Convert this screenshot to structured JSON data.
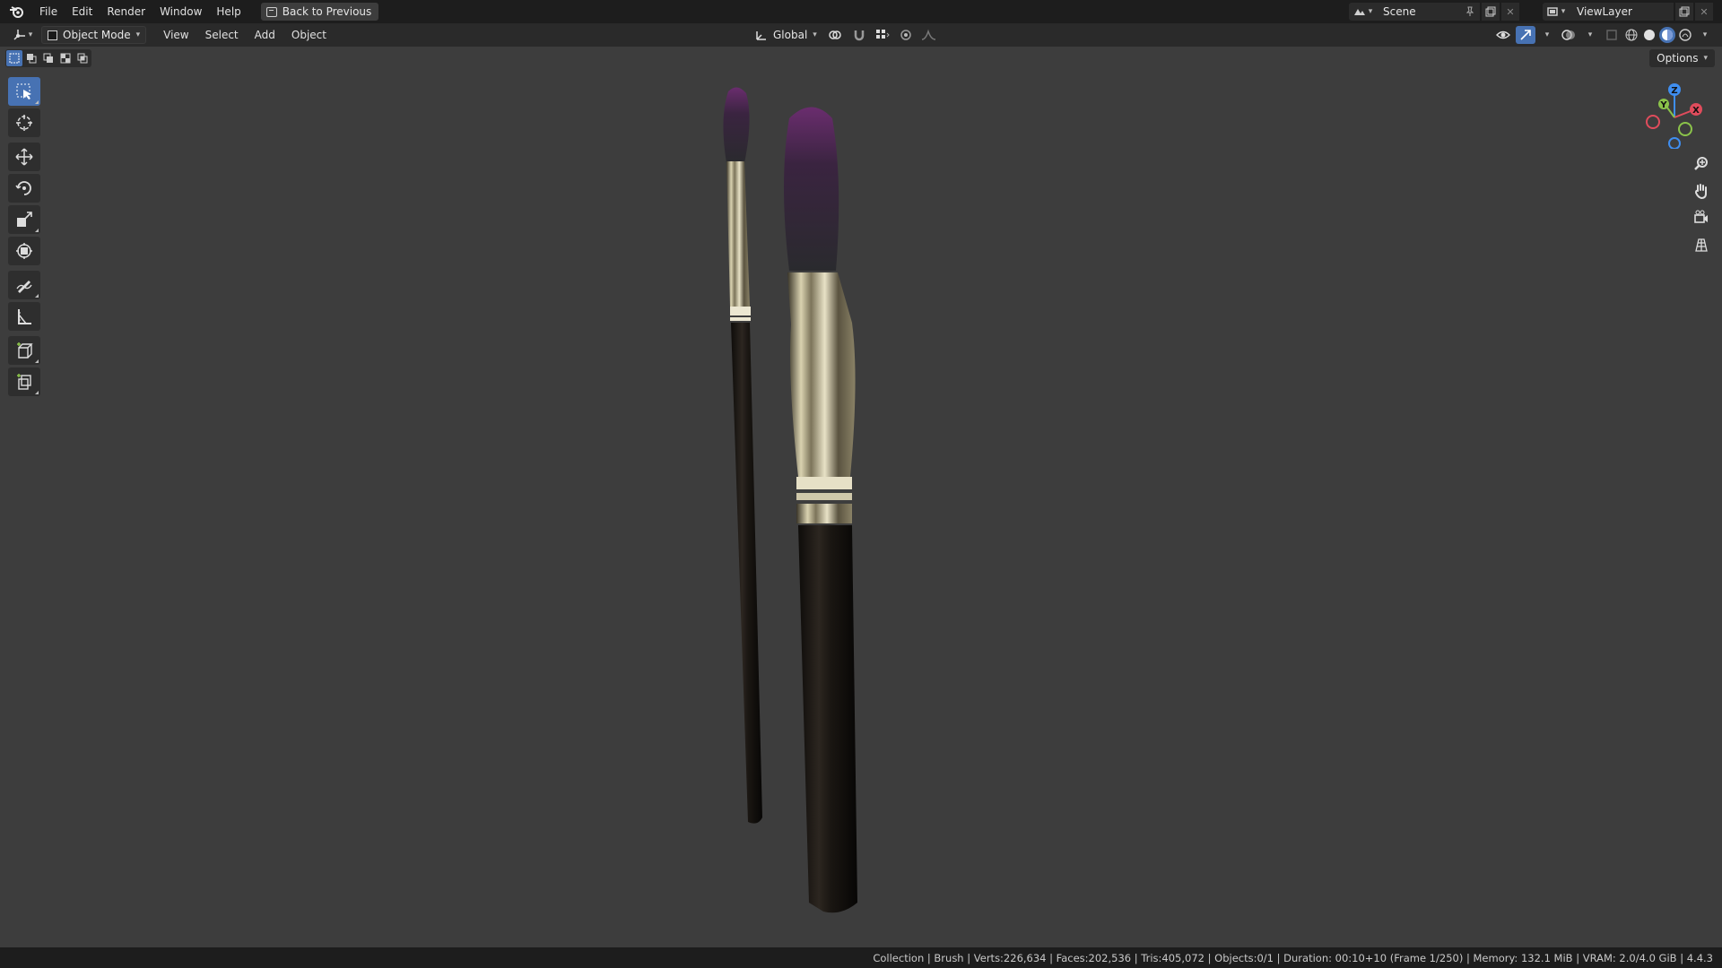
{
  "topbar": {
    "menus": [
      "File",
      "Edit",
      "Render",
      "Window",
      "Help"
    ],
    "back_button": "Back to Previous",
    "scene_name": "Scene",
    "view_layer": "ViewLayer"
  },
  "header": {
    "mode": "Object Mode",
    "menus": [
      "View",
      "Select",
      "Add",
      "Object"
    ],
    "orientation": "Global"
  },
  "viewport": {
    "options_label": "Options",
    "gizmo_axes": [
      "X",
      "Y",
      "Z"
    ],
    "toolbar_tools": [
      "select-box",
      "cursor",
      "move",
      "rotate",
      "scale",
      "transform",
      "annotate",
      "measure",
      "add-cube",
      "add-cylinder"
    ]
  },
  "statusbar": {
    "text": "Collection | Brush | Verts:226,634 | Faces:202,536 | Tris:405,072 | Objects:0/1 | Duration: 00:10+10 (Frame 1/250) | Memory: 132.1 MiB | VRAM: 2.0/4.0 GiB | 4.4.3"
  },
  "colors": {
    "accent": "#4772b3",
    "viewport_bg": "#3d3d3d",
    "axis_x": "#e04c5c",
    "axis_y": "#8bc34a",
    "axis_z": "#3f8ef0",
    "bristle": "#5a2a5c"
  }
}
